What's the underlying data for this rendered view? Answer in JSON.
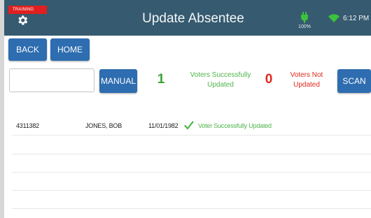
{
  "header": {
    "training_badge": "TRAINING",
    "title": "Update Absentee",
    "battery": "100%",
    "time": "6:12 PM",
    "icons": {
      "settings": "gear-icon",
      "battery": "battery-icon",
      "wifi": "wifi-icon"
    },
    "colors": {
      "bar": "#365a6f",
      "badge": "#e02020",
      "status_icon": "#3bc33b"
    }
  },
  "toolbar": {
    "back_label": "BACK",
    "home_label": "HOME"
  },
  "scan_panel": {
    "voter_input": {
      "value": "",
      "placeholder": ""
    },
    "manual_label": "MANUAL",
    "scan_label": "SCAN",
    "success_count": "1",
    "success_label": "Voters Successfully Updated",
    "fail_count": "0",
    "fail_label": "Voters Not Updated",
    "colors": {
      "button": "#2e6db0",
      "success": "#39a532",
      "fail": "#e0281e"
    }
  },
  "results": {
    "rows": [
      {
        "voter_id": "4311382",
        "name": "JONES, BOB",
        "dob": "11/01/1982",
        "status": "Voter Successfully Updated",
        "status_icon": "check-icon"
      }
    ]
  }
}
